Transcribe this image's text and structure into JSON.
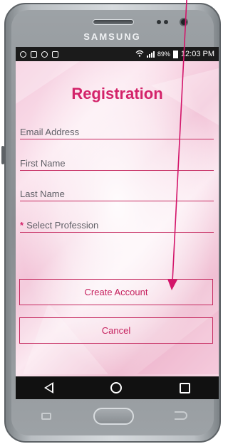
{
  "device": {
    "brand": "SAMSUNG"
  },
  "status_bar": {
    "battery_percent": "89%",
    "time": "12:03 PM"
  },
  "screen": {
    "title": "Registration",
    "fields": [
      {
        "placeholder": "Email Address",
        "required": false
      },
      {
        "placeholder": "First Name",
        "required": false
      },
      {
        "placeholder": "Last Name",
        "required": false
      },
      {
        "placeholder": "Select Profession",
        "required": true,
        "required_marker": "*"
      }
    ],
    "buttons": {
      "create_account": "Create Account",
      "cancel": "Cancel"
    }
  },
  "colors": {
    "accent": "#d3236a",
    "field_line": "#c5295f",
    "annotation_arrow": "#d3156a"
  },
  "icons": {
    "navbar": [
      "back-icon",
      "home-icon",
      "recent-apps-icon"
    ],
    "hardware": [
      "menu-key-icon",
      "home-key",
      "back-key-icon"
    ]
  }
}
